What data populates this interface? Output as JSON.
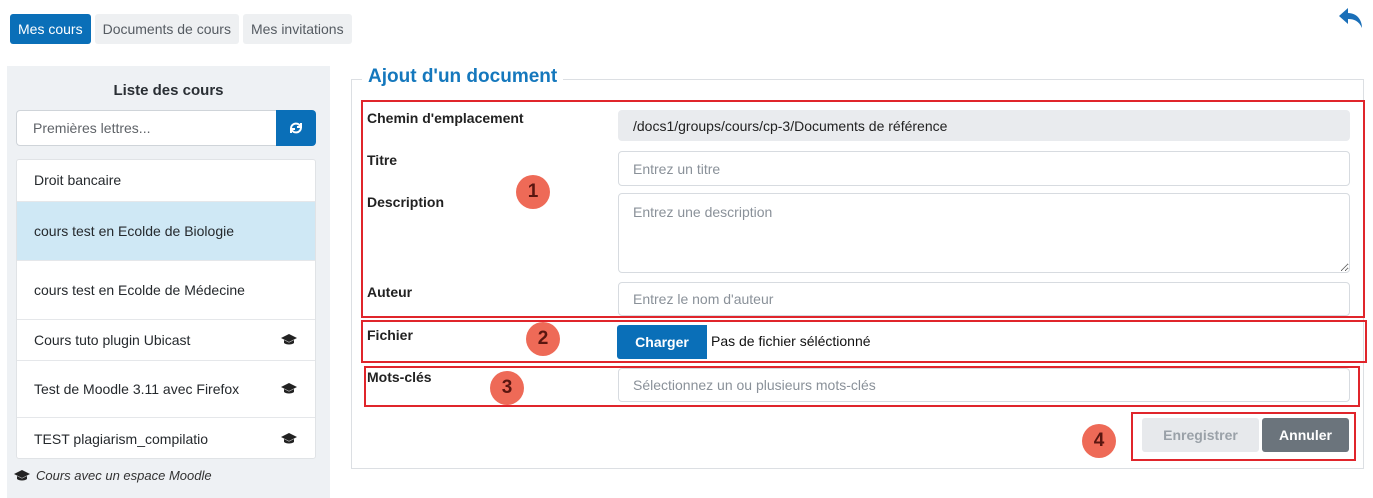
{
  "tabs": [
    {
      "label": "Mes cours",
      "active": true
    },
    {
      "label": "Documents de cours",
      "active": false
    },
    {
      "label": "Mes invitations",
      "active": false
    }
  ],
  "sidebar": {
    "title": "Liste des cours",
    "search_placeholder": "Premières lettres...",
    "courses": [
      {
        "label": "Droit bancaire",
        "has_moodle": false,
        "selected": false
      },
      {
        "label": "cours test en Ecolde de Biologie",
        "has_moodle": false,
        "selected": true
      },
      {
        "label": "cours test en Ecolde de Médecine",
        "has_moodle": false,
        "selected": false
      },
      {
        "label": "Cours tuto plugin Ubicast",
        "has_moodle": true,
        "selected": false
      },
      {
        "label": "Test de Moodle 3.11 avec Firefox",
        "has_moodle": true,
        "selected": false
      },
      {
        "label": "TEST plagiarism_compilatio",
        "has_moodle": true,
        "selected": false
      }
    ],
    "legend": "Cours avec un espace Moodle"
  },
  "form": {
    "title": "Ajout d'un document",
    "path_label": "Chemin d'emplacement",
    "path_value": "/docs1/groups/cours/cp-3/Documents de référence",
    "title_label": "Titre",
    "title_placeholder": "Entrez un titre",
    "description_label": "Description",
    "description_placeholder": "Entrez une description",
    "author_label": "Auteur",
    "author_placeholder": "Entrez le nom d'auteur",
    "file_label": "Fichier",
    "upload_button": "Charger",
    "file_status": "Pas de fichier séléctionné",
    "keywords_label": "Mots-clés",
    "keywords_placeholder": "Sélectionnez un ou plusieurs mots-clés",
    "save_button": "Enregistrer",
    "cancel_button": "Annuler"
  },
  "annotations": [
    "1",
    "2",
    "3",
    "4"
  ],
  "colors": {
    "primary": "#0a6fb8",
    "annotation": "#e0252b",
    "badge": "#ee6a57"
  }
}
